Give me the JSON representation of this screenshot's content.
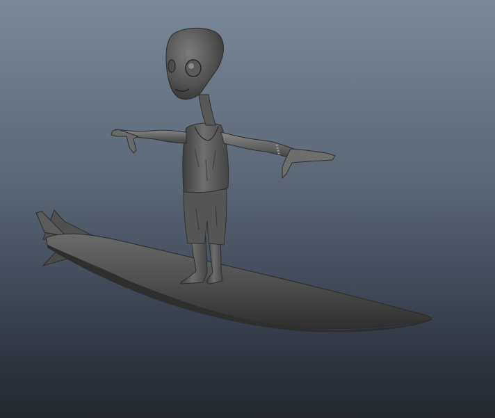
{
  "viewport": {
    "background_top": "#7b8898",
    "background_bottom": "#23272e"
  },
  "scene": {
    "objects": [
      "alien-character",
      "surfboard"
    ],
    "shading_color": "#5a5a5a",
    "highlight_color": "#8a8a8a",
    "shadow_color": "#2e2e2e"
  }
}
